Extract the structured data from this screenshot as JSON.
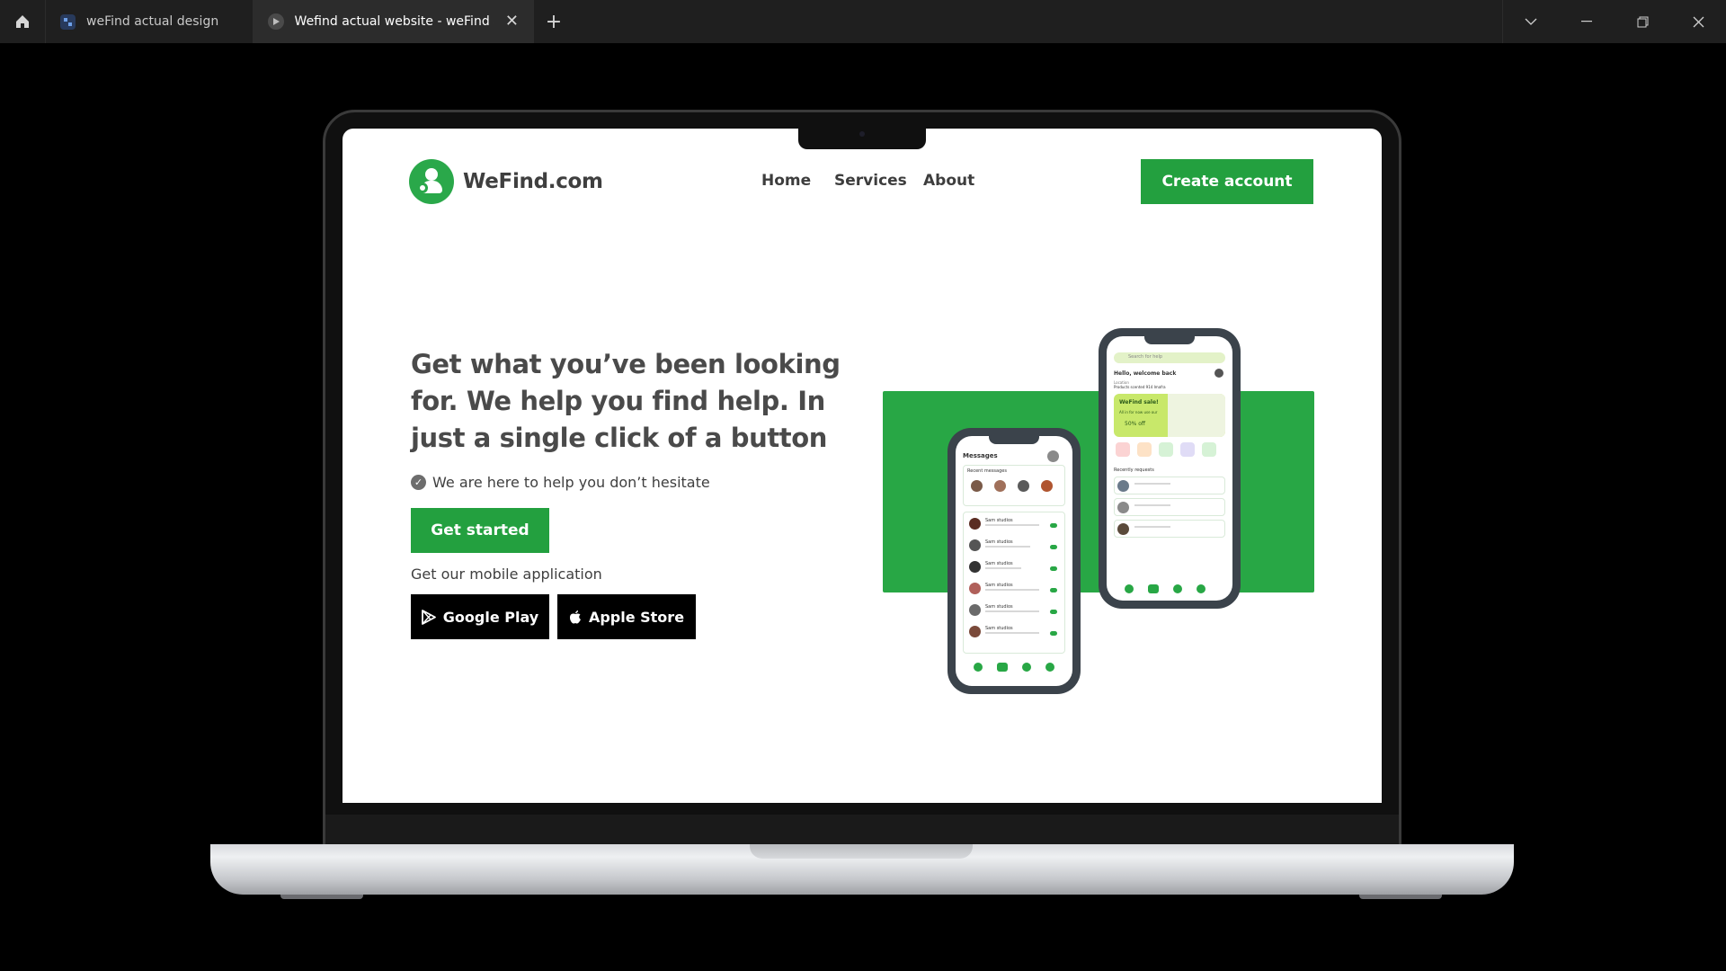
{
  "browser": {
    "tabs": [
      {
        "title": "weFind actual design",
        "icon": "figma-file-icon",
        "active": false
      },
      {
        "title": "Wefind actual website - weFind actual design",
        "icon": "prototype-play-icon",
        "active": true
      }
    ],
    "new_tab_label": "+",
    "window_controls": [
      "chevron-down-icon",
      "minimize-icon",
      "restore-icon",
      "close-icon"
    ]
  },
  "site": {
    "logo_text": "WeFind.com",
    "nav": {
      "home": "Home",
      "services": "Services",
      "about": "About"
    },
    "create_account": "Create account",
    "hero": {
      "title": "Get what you’ve been looking for. We help you find help. In just a single click of a button",
      "tagline": "We are here to help you don’t hesitate",
      "cta": "Get started",
      "mobile_label": "Get our mobile application",
      "google_play": "Google Play",
      "apple_store": "Apple Store"
    },
    "phone_left": {
      "title": "Messages",
      "recent": "Recent messages",
      "rows": [
        "Sam studios",
        "Sam studios",
        "Sam studios",
        "Sam studios",
        "Sam studios",
        "Sam studios"
      ]
    },
    "phone_right": {
      "search": "Search for help",
      "greeting": "Hello, welcome back",
      "location_label": "Location",
      "location": "Products scented 914 Imafra",
      "promo_title": "WeFind sale!",
      "promo_sub": "All in for now use our",
      "promo_discount": "50% off",
      "recent_requests": "Recently requests"
    }
  },
  "colors": {
    "brand_green": "#23a03f",
    "panel_green": "#28a745",
    "text_dark": "#3f3f3f"
  }
}
